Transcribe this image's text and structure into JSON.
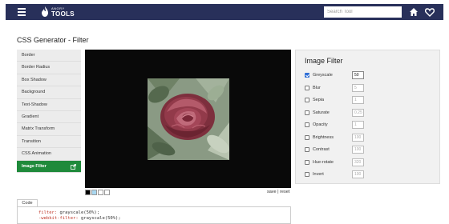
{
  "header": {
    "logo_top": "ANGRY",
    "logo_bottom": "TOOLS",
    "search_placeholder": "Search Tool",
    "bg_color": "#28305a"
  },
  "page": {
    "title": "CSS Generator - Filter"
  },
  "sidebar": {
    "items": [
      {
        "label": "Border"
      },
      {
        "label": "Border Radius"
      },
      {
        "label": "Box Shadow"
      },
      {
        "label": "Background"
      },
      {
        "label": "Text-Shadow"
      },
      {
        "label": "Gradient"
      },
      {
        "label": "Matrix Transform"
      },
      {
        "label": "Transition"
      },
      {
        "label": "CSS Animation"
      },
      {
        "label": "Image Filter",
        "active": true
      }
    ],
    "active_color": "#1f8a3b"
  },
  "preview": {
    "swatches": [
      "#000000",
      "#a9d7f0",
      "#ffffff",
      "#ffffff"
    ],
    "save_reset": "save | reset"
  },
  "filter_panel": {
    "title": "Image Filter",
    "filters": [
      {
        "label": "Greyscale",
        "value": "50",
        "checked": true
      },
      {
        "label": "Blur",
        "value": "5",
        "checked": false
      },
      {
        "label": "Sepia",
        "value": "1",
        "checked": false
      },
      {
        "label": "Saturate",
        "value": "0.25",
        "checked": false
      },
      {
        "label": "Opacity",
        "value": "1",
        "checked": false
      },
      {
        "label": "Brightness",
        "value": "100",
        "checked": false
      },
      {
        "label": "Contrast",
        "value": "100",
        "checked": false
      },
      {
        "label": "Hue-rotate",
        "value": "320",
        "checked": false
      },
      {
        "label": "Invert",
        "value": "100",
        "checked": false
      }
    ]
  },
  "code": {
    "tab_label": "Code",
    "lines": [
      {
        "prop": "filter:",
        "value": " grayscale(50%);"
      },
      {
        "prop": "-webkit-filter:",
        "value": " grayscale(50%);"
      }
    ]
  }
}
